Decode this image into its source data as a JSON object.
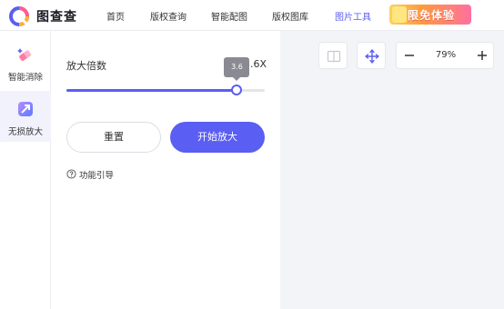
{
  "brand": {
    "name": "图查查"
  },
  "nav": {
    "items": [
      {
        "label": "首页"
      },
      {
        "label": "版权查询"
      },
      {
        "label": "智能配图"
      },
      {
        "label": "版权图库"
      },
      {
        "label": "图片工具"
      }
    ],
    "active_index": 4,
    "promo_label": "限免体验"
  },
  "sidebar": {
    "items": [
      {
        "label": "智能消除",
        "icon": "magic-eraser-icon",
        "active": false
      },
      {
        "label": "无损放大",
        "icon": "enlarge-icon",
        "active": true
      }
    ]
  },
  "panel": {
    "scale_label": "放大倍数",
    "scale_value_text": "3.6X",
    "slider": {
      "value": 3.6,
      "tooltip": "3.6",
      "min": 1,
      "max": 4,
      "fill_fraction": 0.86
    },
    "reset_label": "重置",
    "start_label": "开始放大",
    "guide_label": "功能引导"
  },
  "canvas": {
    "zoom_text": "79%"
  },
  "colors": {
    "accent": "#5a5ef2",
    "promo_start": "#ffd15c",
    "promo_end": "#ff6fa0",
    "canvas_bg": "#f3f4f7"
  }
}
